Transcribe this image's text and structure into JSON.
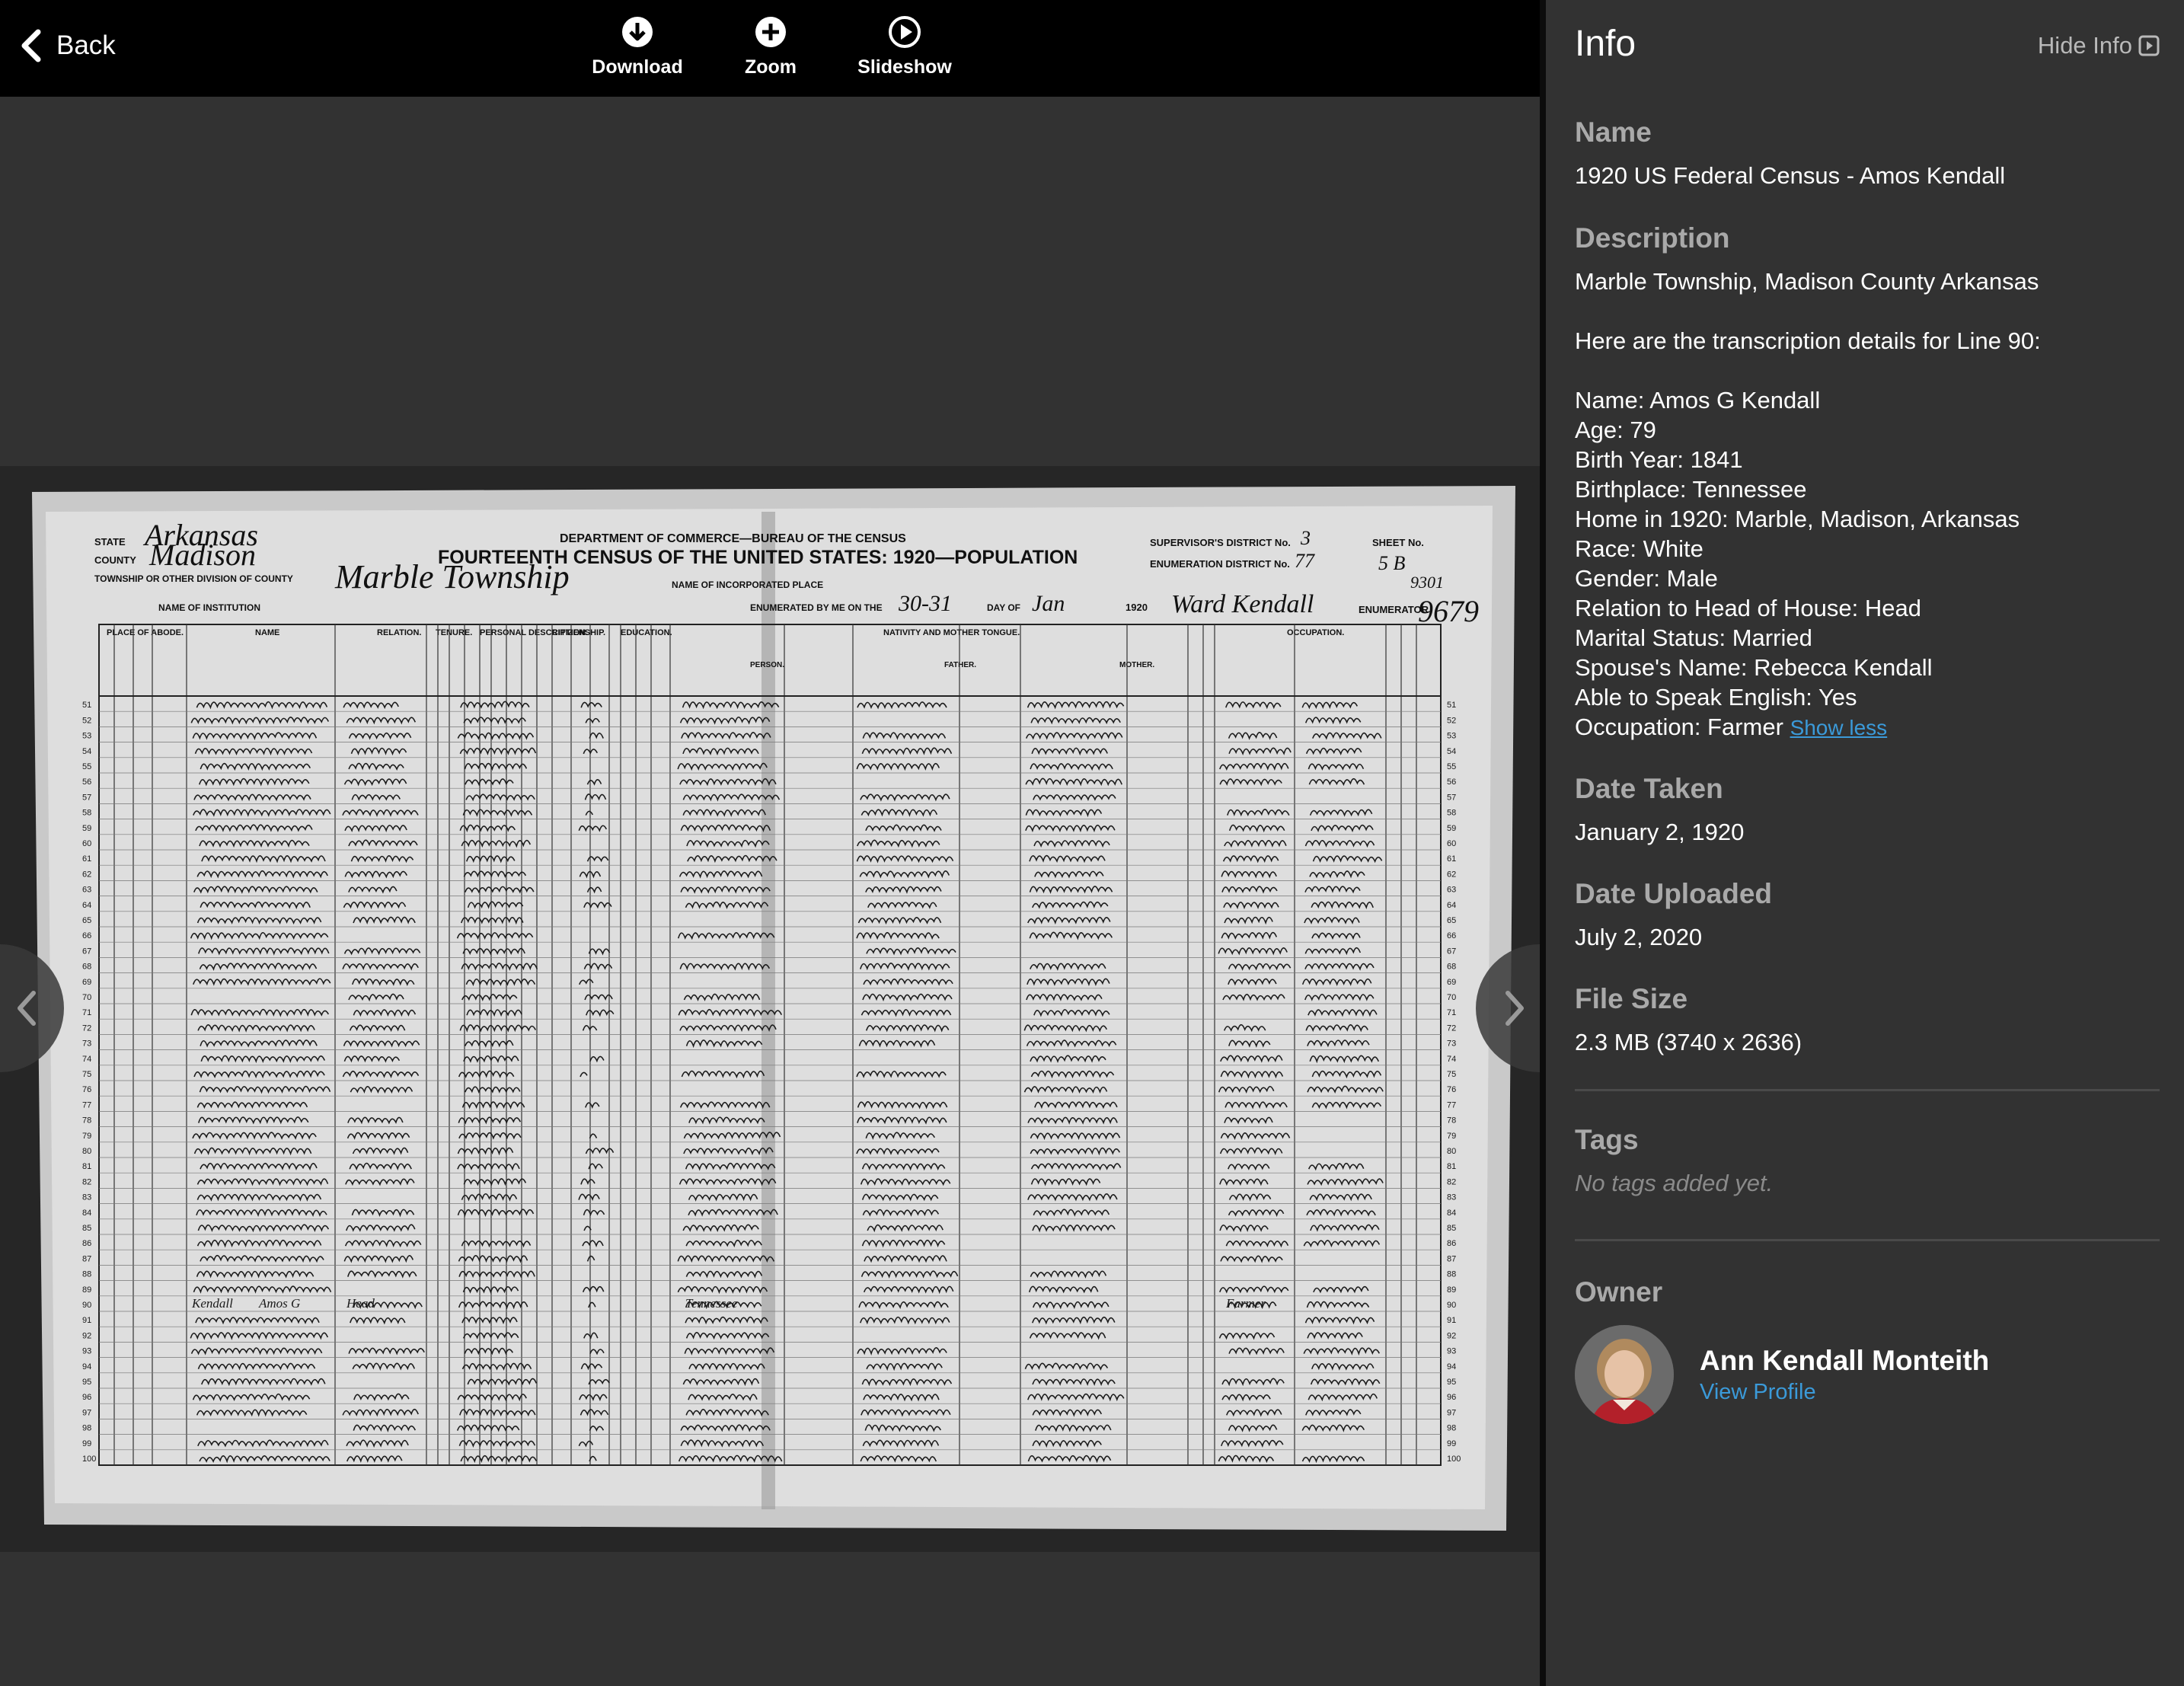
{
  "toolbar": {
    "back_label": "Back",
    "download_label": "Download",
    "zoom_label": "Zoom",
    "slideshow_label": "Slideshow"
  },
  "document": {
    "header_title": "FOURTEENTH CENSUS OF THE UNITED STATES: 1920—POPULATION",
    "header_dept": "DEPARTMENT OF COMMERCE—BUREAU OF THE CENSUS",
    "state_label": "STATE",
    "county_label": "COUNTY",
    "township_label": "TOWNSHIP OR OTHER DIVISION OF COUNTY",
    "institution_label": "NAME OF INSTITUTION",
    "state_value": "Arkansas",
    "county_value": "Madison",
    "township_value": "Marble Township",
    "sheet_label": "SHEET No.",
    "sheet_value": "5 B",
    "supervisor_label": "SUPERVISOR'S DISTRICT No.",
    "supervisor_value": "3",
    "enumeration_label": "ENUMERATION DISTRICT No.",
    "enumeration_value": "77",
    "enumerator_label": "ENUMERATOR",
    "incorporated_label": "NAME OF INCORPORATED PLACE",
    "enumerated_label": "ENUMERATED BY ME ON THE",
    "day_label": "DAY OF",
    "day_value": "30-31",
    "month_value": "Jan",
    "year_value": "1920",
    "enumerator_value": "Ward Kendall",
    "stamp_top": "9301",
    "stamp_side": "9679",
    "col_place": "PLACE OF ABODE.",
    "col_name": "NAME",
    "col_relation": "RELATION.",
    "col_tenure": "TENURE.",
    "col_personal": "PERSONAL DESCRIPTION.",
    "col_citizenship": "CITIZENSHIP.",
    "col_education": "EDUCATION.",
    "col_nativity": "NATIVITY AND MOTHER TONGUE.",
    "col_occupation": "OCCUPATION.",
    "sub_person": "PERSON.",
    "sub_father": "FATHER.",
    "sub_mother": "MOTHER.",
    "first_line": 51,
    "last_line": 100,
    "highlight_line": 90,
    "highlight_surname": "Kendall",
    "highlight_given": "Amos G",
    "highlight_relation": "Head",
    "highlight_birthplace": "Tennessee",
    "highlight_occupation": "Farmer"
  },
  "panel": {
    "title": "Info",
    "hide_label": "Hide Info",
    "name_label": "Name",
    "name_value": "1920 US Federal Census - Amos Kendall",
    "description_label": "Description",
    "description_lines": [
      "Marble Township, Madison County Arkansas",
      "",
      "Here are the transcription details for Line 90:",
      "",
      "Name:  Amos G Kendall",
      "Age:  79",
      "Birth Year:  1841",
      "Birthplace:  Tennessee",
      "Home in 1920:  Marble, Madison, Arkansas",
      "Race:  White",
      "Gender:  Male",
      "Relation to Head of House:  Head",
      "Marital Status:  Married",
      "Spouse's Name:  Rebecca Kendall",
      "Able to Speak English:  Yes",
      "Occupation:  Farmer"
    ],
    "show_less": "Show less",
    "date_taken_label": "Date Taken",
    "date_taken_value": "January 2, 1920",
    "date_uploaded_label": "Date Uploaded",
    "date_uploaded_value": "July 2, 2020",
    "file_size_label": "File Size",
    "file_size_value": "2.3 MB (3740 x 2636)",
    "tags_label": "Tags",
    "tags_value": "No tags added yet.",
    "owner_label": "Owner",
    "owner_name": "Ann Kendall Monteith",
    "view_profile": "View Profile"
  },
  "colors": {
    "topbar": "#000000",
    "background": "#323232",
    "label_grey": "#a9a9a9",
    "link_blue": "#3b9ad9"
  },
  "icons": {
    "back": "chevron-left-icon",
    "download": "download-circle-icon",
    "zoom": "plus-circle-icon",
    "slideshow": "play-circle-icon",
    "hide_info": "box-arrow-right-icon",
    "prev": "chevron-left-icon",
    "next": "chevron-right-icon"
  }
}
